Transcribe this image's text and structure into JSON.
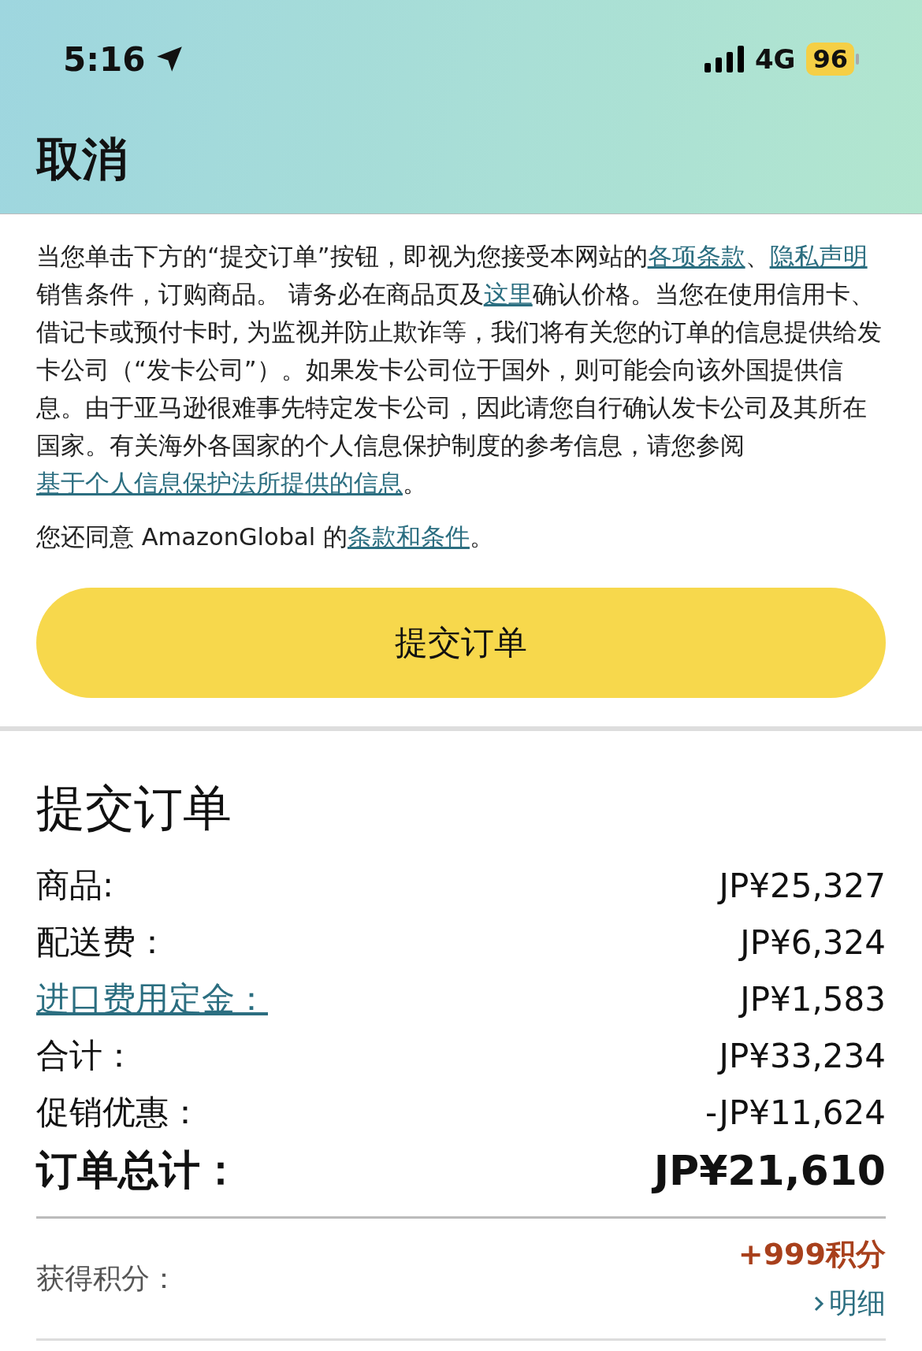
{
  "status_bar": {
    "time": "5:16",
    "network": "4G",
    "battery": "96"
  },
  "header": {
    "title": "取消"
  },
  "notice": {
    "paragraphs": [
      [
        {
          "kind": "text",
          "text": "当您单击下方的“提交订单”按钮，即视为您接受本网站的"
        },
        {
          "kind": "link",
          "text": "各项条款"
        },
        {
          "kind": "text",
          "text": "、"
        },
        {
          "kind": "link",
          "text": "隐私声明"
        },
        {
          "kind": "text",
          "text": "销售条件，订购商品。 请务必在商品页及"
        },
        {
          "kind": "link",
          "text": "这里"
        },
        {
          "kind": "text",
          "text": "确认价格。当您在使用信用卡、借记卡或预付卡时, 为监视并防止欺诈等，我们将有关您的订单的信息提供给发卡公司（“发卡公司”）。如果发卡公司位于国外，则可能会向该外国提供信息。由于亚马逊很难事先特定发卡公司，因此请您自行确认发卡公司及其所在国家。有关海外各国家的个人信息保护制度的参考信息，请您参阅"
        },
        {
          "kind": "link",
          "text": "基于个人信息保护法所提供的信息"
        },
        {
          "kind": "text",
          "text": "。"
        }
      ],
      [
        {
          "kind": "text",
          "text": "您还同意 AmazonGlobal 的"
        },
        {
          "kind": "link",
          "text": "条款和条件"
        },
        {
          "kind": "text",
          "text": "。"
        }
      ]
    ],
    "button": "提交订单"
  },
  "summary": {
    "title": "提交订单",
    "rows": [
      {
        "kind": "text",
        "label": "商品:",
        "value": "JP¥25,327"
      },
      {
        "kind": "text",
        "label": "配送费：",
        "value": "JP¥6,324"
      },
      {
        "kind": "link",
        "label": "进口费用定金：",
        "value": "JP¥1,583"
      },
      {
        "kind": "text",
        "label": "合计：",
        "value": "JP¥33,234"
      },
      {
        "kind": "text",
        "label": "促销优惠：",
        "value": "-JP¥11,624"
      },
      {
        "kind": "total",
        "label": "订单总计：",
        "value": "JP¥21,610"
      }
    ],
    "points": {
      "label": "获得积分：",
      "value": "+999积分",
      "details": "明细"
    }
  }
}
